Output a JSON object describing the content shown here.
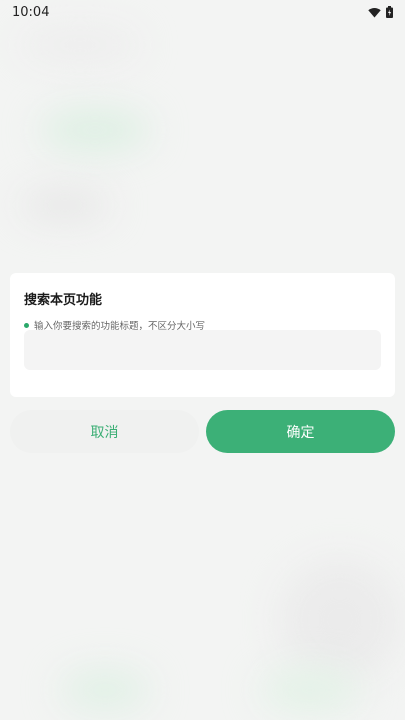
{
  "status_bar": {
    "time": "10:04",
    "icons": [
      "wifi-icon",
      "battery-icon"
    ]
  },
  "dialog": {
    "title": "搜索本页功能",
    "hint": "输入你要搜索的功能标题，不区分大小写",
    "input_value": "",
    "input_placeholder": ""
  },
  "buttons": {
    "cancel": "取消",
    "confirm": "确定"
  },
  "colors": {
    "accent": "#3cb077",
    "hint_dot": "#2aa86a",
    "cancel_text": "#3aae74"
  }
}
